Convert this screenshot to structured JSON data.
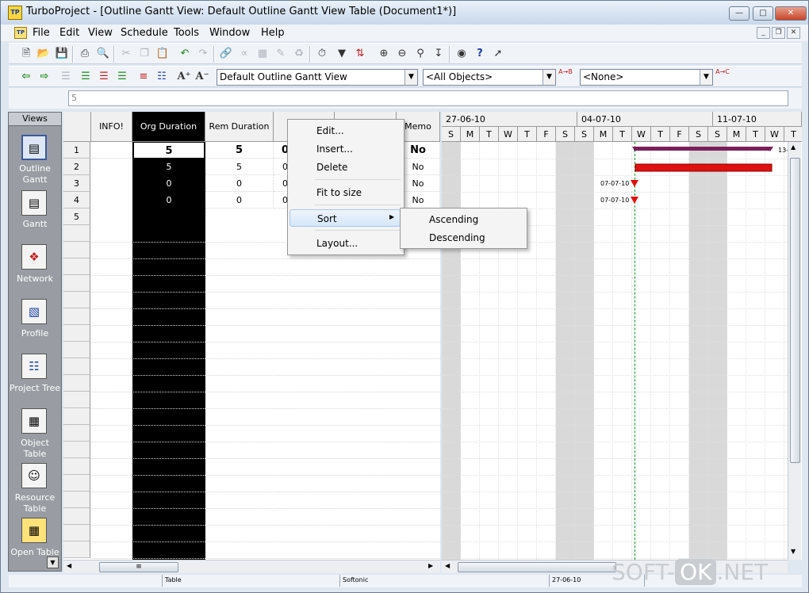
{
  "window": {
    "title": "TurboProject - [Outline Gantt View: Default Outline Gantt View Table (Document1*)]",
    "app_icon": "TP"
  },
  "menus": [
    "File",
    "Edit",
    "View",
    "Schedule",
    "Tools",
    "Window",
    "Help"
  ],
  "toolbar1": {
    "icons": [
      "new-icon",
      "open-icon",
      "save-icon",
      "print-icon",
      "print-preview-icon",
      "cut-icon",
      "copy-icon",
      "paste-icon",
      "undo-icon",
      "redo-icon",
      "link-icon",
      "unlink-icon",
      "table-icon",
      "notes-icon",
      "assign-icon",
      "clock-icon",
      "filter-icon",
      "sort-icon",
      "zoom-in-icon",
      "zoom-out-icon",
      "zoom-fit-icon",
      "goto-icon",
      "camera-icon",
      "help-icon",
      "whats-this-icon"
    ]
  },
  "toolbar2": {
    "icons": [
      "arrow-left-icon",
      "arrow-right-icon",
      "outdent-icon",
      "indent-icon",
      "expand-icon",
      "collapse-icon",
      "timescale-icon",
      "font-larger-icon",
      "font-smaller-icon"
    ],
    "view_select": "Default Outline Gantt View",
    "object_filter": "<All Objects>",
    "sort_select": "<None>"
  },
  "editbar": {
    "value": "5"
  },
  "views": {
    "header": "Views",
    "items": [
      {
        "label": "Outline Gantt",
        "icon": "outline-gantt-icon"
      },
      {
        "label": "Gantt",
        "icon": "gantt-icon"
      },
      {
        "label": "Network",
        "icon": "network-icon"
      },
      {
        "label": "Profile",
        "icon": "profile-icon"
      },
      {
        "label": "Project Tree",
        "icon": "project-tree-icon"
      },
      {
        "label": "Object Table",
        "icon": "object-table-icon"
      },
      {
        "label": "Resource Table",
        "icon": "resource-table-icon"
      },
      {
        "label": "Open Table",
        "icon": "open-table-icon"
      }
    ]
  },
  "table": {
    "columns": [
      "INFO!",
      "Org Duration",
      "Rem Duration",
      "",
      "",
      "Memo"
    ],
    "rows": [
      {
        "num": "1",
        "info": "",
        "org": "5",
        "rem": "5",
        "c4": "0",
        "c5": "",
        "memo": "No"
      },
      {
        "num": "2",
        "info": "",
        "org": "5",
        "rem": "5",
        "c4": "0",
        "c5": "",
        "memo": "No"
      },
      {
        "num": "3",
        "info": "",
        "org": "0",
        "rem": "0",
        "c4": "0",
        "c5": "",
        "memo": "No"
      },
      {
        "num": "4",
        "info": "",
        "org": "0",
        "rem": "0",
        "c4": "0",
        "c5": "",
        "memo": "No"
      },
      {
        "num": "5",
        "info": "",
        "org": "",
        "rem": "",
        "c4": "",
        "c5": "",
        "memo": ""
      }
    ]
  },
  "gantt": {
    "weeks": [
      "27-06-10",
      "04-07-10",
      "11-07-10"
    ],
    "days": [
      "S",
      "M",
      "T",
      "W",
      "T",
      "F",
      "S",
      "S",
      "M",
      "T",
      "W",
      "T",
      "F",
      "S",
      "S",
      "M",
      "T",
      "W",
      "T"
    ],
    "bar_labels": {
      "row1": "13-",
      "row3": "07-07-10",
      "row4": "07-07-10"
    },
    "colors": {
      "summary": "#7a1f5c",
      "task": "#e01010",
      "milestone": "#e01010",
      "today_line": "#1a9a1a"
    }
  },
  "context_menu": {
    "items": [
      "Edit...",
      "Insert...",
      "Delete",
      "Fit to size",
      "Sort",
      "Layout..."
    ],
    "submenu": [
      "Ascending",
      "Descending"
    ]
  },
  "status": {
    "panel2": "Table",
    "panel3": "Softonic",
    "panel4": "27-06-10"
  },
  "watermark": {
    "part1": "SOFT-",
    "part2": "OK",
    "part3": ".NET"
  }
}
